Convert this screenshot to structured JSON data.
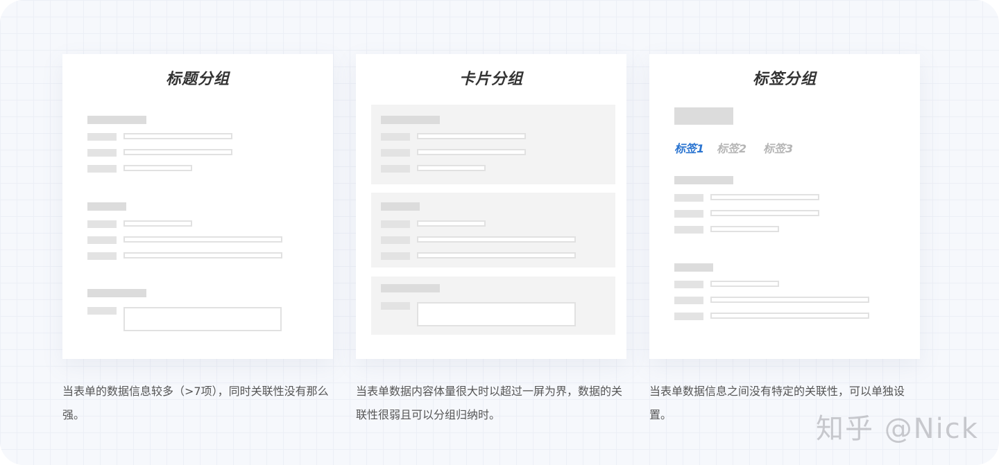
{
  "panels": [
    {
      "title": "标题分组",
      "description": "当表单的数据信息较多（>7项），同时关联性没有那么强。"
    },
    {
      "title": "卡片分组",
      "description": "当表单数据内容体量很大时以超过一屏为界，数据的关联性很弱且可以分组归纳时。"
    },
    {
      "title": "标签分组",
      "tabs": [
        "标签1",
        "标签2",
        "标签3"
      ],
      "description": "当表单数据信息之间没有特定的关联性，可以单独设置。"
    }
  ],
  "colors": {
    "active_tab": "#2a74d0",
    "inactive_tab": "#b5b5b5",
    "placeholder_block": "#dcdcdc",
    "card_background": "#f3f3f3"
  },
  "watermark": "知乎 @Nick"
}
